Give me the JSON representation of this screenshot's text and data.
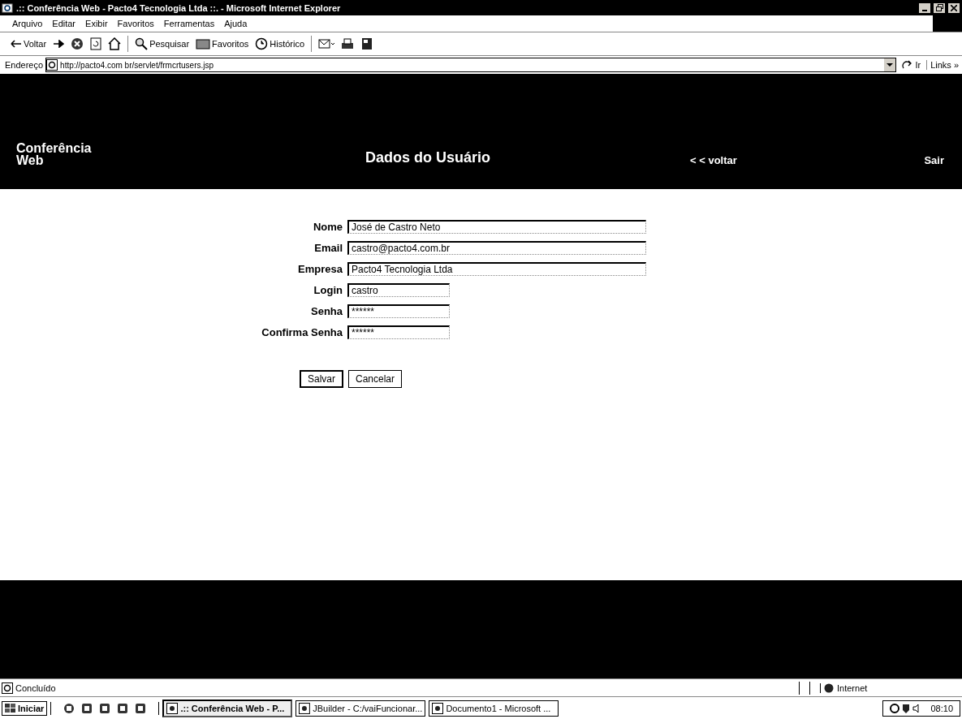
{
  "window": {
    "title": ".:: Conferência Web - Pacto4 Tecnologia Ltda ::. - Microsoft Internet Explorer"
  },
  "menu": [
    "Arquivo",
    "Editar",
    "Exibir",
    "Favoritos",
    "Ferramentas",
    "Ajuda"
  ],
  "toolbar": [
    {
      "kind": "back",
      "label": "Voltar"
    },
    {
      "kind": "forward"
    },
    {
      "kind": "stop"
    },
    {
      "kind": "refresh"
    },
    {
      "kind": "home"
    },
    {
      "kind": "search",
      "label": "Pesquisar"
    },
    {
      "kind": "favorites",
      "label": "Favoritos"
    },
    {
      "kind": "history",
      "label": "Histórico"
    },
    {
      "kind": "mail"
    },
    {
      "kind": "print"
    },
    {
      "kind": "edit"
    }
  ],
  "address": {
    "label": "Endereço",
    "value": "http://pacto4.com br/servlet/frmcrtusers.jsp",
    "go": "Ir",
    "links": "Links »"
  },
  "header": {
    "brand": "Conferência Web",
    "title": "Dados do Usuário",
    "back_link": "< < voltar",
    "exit_link": "Sair"
  },
  "form": {
    "fields": [
      {
        "label": "Nome",
        "value": "José de Castro Neto"
      },
      {
        "label": "Email",
        "value": "castro@pacto4.com.br"
      },
      {
        "label": "Empresa",
        "value": "Pacto4 Tecnologia Ltda"
      },
      {
        "label": "Login",
        "value": "castro"
      },
      {
        "label": "Senha",
        "value": "******"
      },
      {
        "label": "Confirma Senha",
        "value": "******"
      }
    ],
    "buttons": [
      {
        "label": "Salvar",
        "default": true
      },
      {
        "label": "Cancelar",
        "default": false
      }
    ]
  },
  "status_bar": {
    "text": "Concluído",
    "zone": "Internet"
  },
  "taskbar": {
    "start": "Iniciar",
    "tasks": [
      {
        "label": ".:: Conferência Web - P...",
        "selected": true
      },
      {
        "label": "JBuilder - C:/vaiFuncionar...",
        "selected": false
      },
      {
        "label": "Documento1 - Microsoft ...",
        "selected": false
      }
    ],
    "time": "08:10"
  }
}
